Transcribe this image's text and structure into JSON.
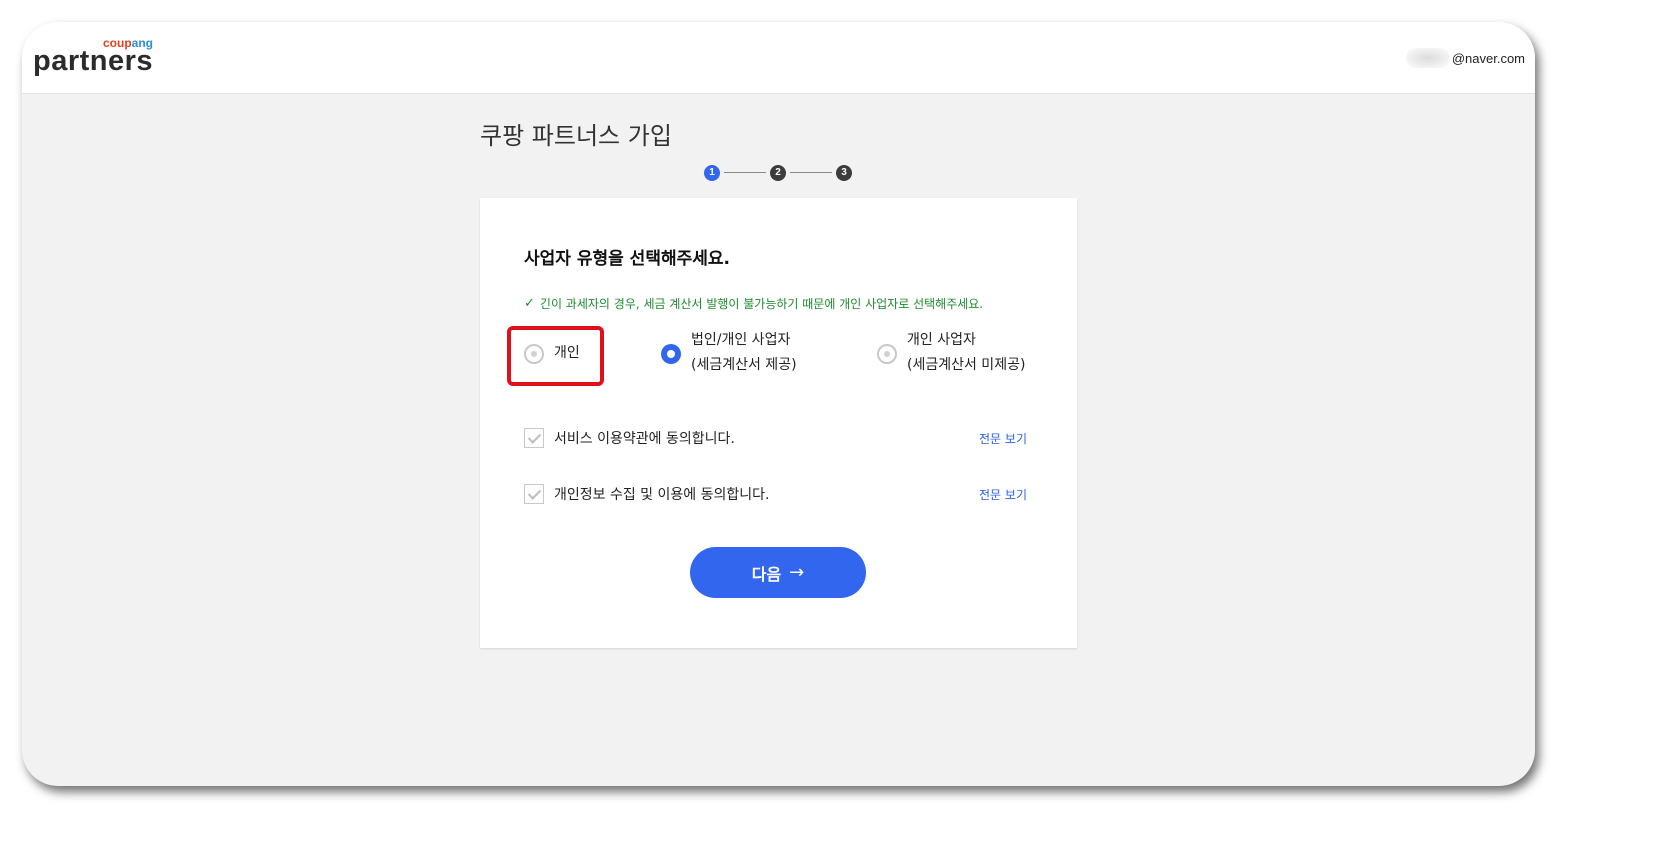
{
  "colors": {
    "accent": "#3366ee",
    "step_active": "#3366ee",
    "step_inactive": "#3c3c3c",
    "notice_green": "#1e8a2e",
    "highlight_red": "#e0101a",
    "logo_orange": "#e0401a",
    "logo_blue": "#2b8fd6"
  },
  "header": {
    "logo_small": "coupang",
    "logo_main": "partners",
    "user_email": "@naver.com"
  },
  "page": {
    "title": "쿠팡 파트너스 가입",
    "steps": [
      "1",
      "2",
      "3"
    ],
    "active_step": 1
  },
  "form": {
    "heading": "사업자 유형을 선택해주세요.",
    "notice_icon": "check-icon",
    "notice": "긴이 과세자의 경우, 세금 계산서 발행이 불가능하기 때문에 개인 사업자로 선택해주세요.",
    "options": [
      {
        "line1": "개인",
        "line2": "",
        "selected": false
      },
      {
        "line1": "법인/개인 사업자",
        "line2": "(세금계산서 제공)",
        "selected": true
      },
      {
        "line1": "개인 사업자",
        "line2": "(세금계산서 미제공)",
        "selected": false
      }
    ],
    "agreements": [
      {
        "label": "서비스 이용약관에 동의합니다.",
        "link": "전문 보기",
        "checked": true
      },
      {
        "label": "개인정보 수집 및 이용에 동의합니다.",
        "link": "전문 보기",
        "checked": true
      }
    ],
    "next_label": "다음",
    "next_arrow": "→"
  }
}
